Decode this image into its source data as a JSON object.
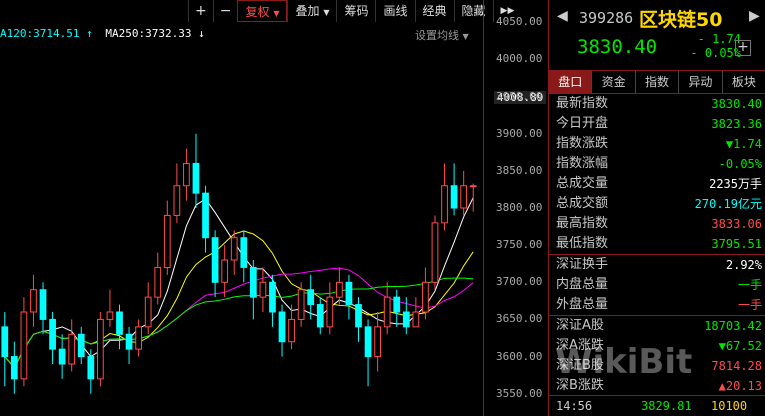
{
  "toolbar": {
    "plus": "+",
    "minus": "−",
    "fuquan": "复权",
    "diejia": "叠加",
    "chouma": "筹码",
    "huaxian": "画线",
    "jingdian": "经典",
    "yincang": "隐藏",
    "more": "▶▶"
  },
  "ma_line": {
    "ma120": "A120:3714.51",
    "ma120_arrow": "↑",
    "ma250": "MA250:3732.33",
    "ma250_arrow": "↓"
  },
  "set_ma": "设置均线",
  "y_axis": {
    "ticks": [
      "4050.00",
      "4000.00",
      "3950.00",
      "3900.00",
      "3850.00",
      "3800.00",
      "3750.00",
      "3700.00",
      "3650.00",
      "3600.00",
      "3550.00"
    ],
    "current_tag": "4008.89"
  },
  "colors": {
    "up": "#ff4b4b",
    "down": "#00ffff",
    "accent": "#8a1a1a",
    "green": "#00e600",
    "gold": "#ffd700"
  },
  "quote": {
    "code": "399286",
    "name": "区块链50",
    "price": "3830.40",
    "change": "- 1.74",
    "change_pct": "- 0.05%",
    "add": "+"
  },
  "tabs": [
    "盘口",
    "资金",
    "指数",
    "异动",
    "板块"
  ],
  "rows1": [
    {
      "label": "最新指数",
      "value": "3830.40",
      "cls": "g"
    },
    {
      "label": "今日开盘",
      "value": "3823.36",
      "cls": "g"
    },
    {
      "label": "指数涨跌",
      "value": "▼1.74",
      "cls": "g"
    },
    {
      "label": "指数涨幅",
      "value": "-0.05%",
      "cls": "g"
    },
    {
      "label": "总成交量",
      "value": "2235万手",
      "cls": "w"
    },
    {
      "label": "总成交额",
      "value": "270.19亿元",
      "cls": "c"
    },
    {
      "label": "最高指数",
      "value": "3833.06",
      "cls": "r"
    },
    {
      "label": "最低指数",
      "value": "3795.51",
      "cls": "g"
    }
  ],
  "rows2": [
    {
      "label": "深证换手",
      "value": "2.92%",
      "cls": "w"
    },
    {
      "label": "内盘总量",
      "value": "一手",
      "cls": "g"
    },
    {
      "label": "外盘总量",
      "value": "一手",
      "cls": "r"
    }
  ],
  "rows3": [
    {
      "label": "深证A股",
      "value": "18703.42",
      "cls": "g"
    },
    {
      "label": "深A涨跌",
      "value": "▼67.52",
      "cls": "g"
    },
    {
      "label": "深证B股",
      "value": "7814.28",
      "cls": "r"
    },
    {
      "label": "深B涨跌",
      "value": "▲20.13",
      "cls": "r"
    }
  ],
  "footer": {
    "time": "14:56",
    "price": "3829.81",
    "volume": "10100"
  },
  "watermark": "WikiBit",
  "chart_data": {
    "type": "candlestick",
    "ylim": [
      3520,
      4080
    ],
    "candles": [
      [
        3640,
        3600,
        3660,
        3560
      ],
      [
        3600,
        3570,
        3620,
        3550
      ],
      [
        3570,
        3660,
        3680,
        3560
      ],
      [
        3660,
        3690,
        3710,
        3640
      ],
      [
        3690,
        3650,
        3700,
        3630
      ],
      [
        3650,
        3610,
        3660,
        3590
      ],
      [
        3610,
        3590,
        3630,
        3570
      ],
      [
        3590,
        3630,
        3650,
        3580
      ],
      [
        3630,
        3600,
        3640,
        3590
      ],
      [
        3600,
        3570,
        3610,
        3550
      ],
      [
        3570,
        3650,
        3660,
        3560
      ],
      [
        3650,
        3660,
        3690,
        3640
      ],
      [
        3660,
        3630,
        3670,
        3610
      ],
      [
        3630,
        3610,
        3640,
        3590
      ],
      [
        3610,
        3640,
        3650,
        3600
      ],
      [
        3640,
        3680,
        3700,
        3630
      ],
      [
        3680,
        3720,
        3740,
        3670
      ],
      [
        3720,
        3790,
        3810,
        3710
      ],
      [
        3790,
        3830,
        3860,
        3780
      ],
      [
        3830,
        3860,
        3880,
        3810
      ],
      [
        3860,
        3820,
        3900,
        3800
      ],
      [
        3820,
        3760,
        3830,
        3740
      ],
      [
        3760,
        3700,
        3770,
        3680
      ],
      [
        3700,
        3730,
        3750,
        3680
      ],
      [
        3730,
        3760,
        3770,
        3710
      ],
      [
        3760,
        3720,
        3770,
        3700
      ],
      [
        3720,
        3680,
        3730,
        3650
      ],
      [
        3680,
        3700,
        3720,
        3660
      ],
      [
        3700,
        3660,
        3710,
        3640
      ],
      [
        3660,
        3620,
        3670,
        3600
      ],
      [
        3620,
        3650,
        3670,
        3610
      ],
      [
        3650,
        3690,
        3700,
        3640
      ],
      [
        3690,
        3670,
        3710,
        3650
      ],
      [
        3670,
        3640,
        3680,
        3630
      ],
      [
        3640,
        3680,
        3700,
        3630
      ],
      [
        3680,
        3700,
        3720,
        3670
      ],
      [
        3700,
        3670,
        3710,
        3650
      ],
      [
        3670,
        3640,
        3680,
        3620
      ],
      [
        3640,
        3600,
        3650,
        3560
      ],
      [
        3600,
        3640,
        3660,
        3580
      ],
      [
        3640,
        3680,
        3700,
        3630
      ],
      [
        3680,
        3660,
        3690,
        3640
      ],
      [
        3660,
        3640,
        3680,
        3630
      ],
      [
        3640,
        3660,
        3680,
        3640
      ],
      [
        3660,
        3700,
        3720,
        3650
      ],
      [
        3700,
        3780,
        3790,
        3690
      ],
      [
        3780,
        3830,
        3860,
        3770
      ],
      [
        3830,
        3800,
        3860,
        3790
      ],
      [
        3800,
        3830,
        3850,
        3790
      ],
      [
        3830,
        3830,
        3833,
        3795
      ]
    ]
  }
}
